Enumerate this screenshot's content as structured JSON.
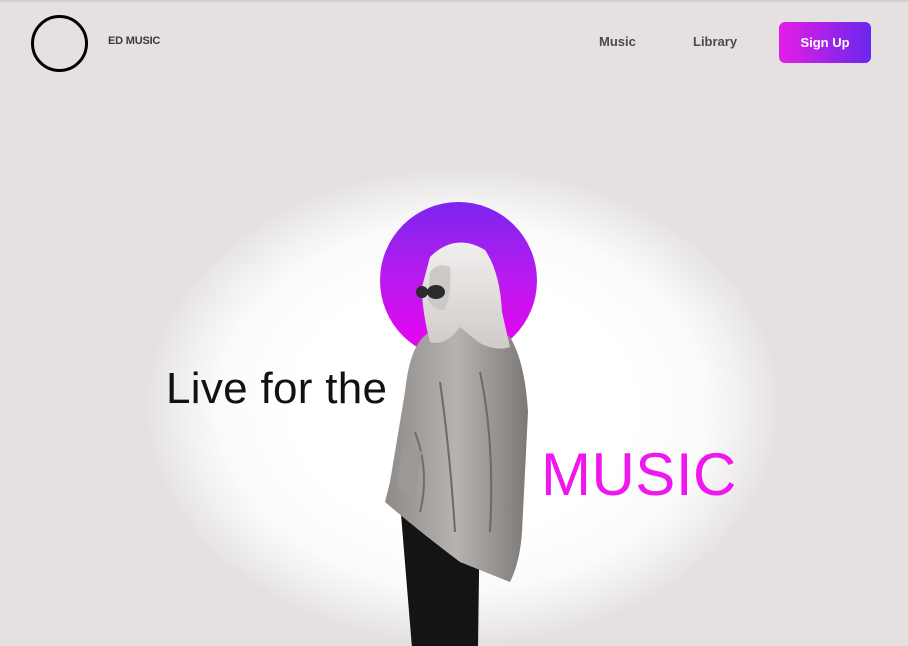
{
  "header": {
    "brand": "ED MUSIC",
    "nav": {
      "music": "Music",
      "library": "Library"
    },
    "signup_label": "Sign Up"
  },
  "hero": {
    "line1": "Live for the",
    "line2": "MUSIC"
  },
  "colors": {
    "accent_pink": "#ee17ee",
    "accent_purple": "#6a26ee",
    "background": "#e5e1e1"
  },
  "icons": {
    "logo": "ring-logo-icon"
  }
}
